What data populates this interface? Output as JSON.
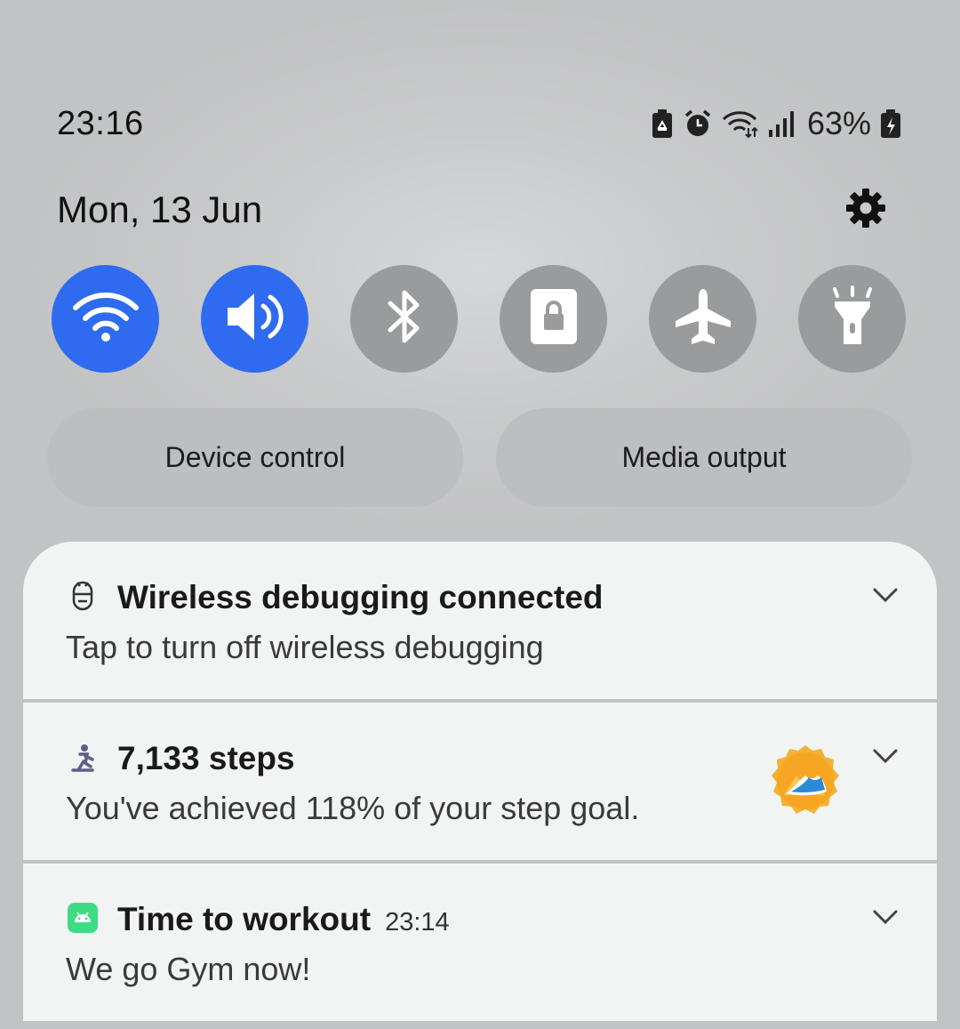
{
  "status_bar": {
    "time": "23:16",
    "battery_percent": "63%",
    "icons": [
      "recycle-battery-icon",
      "alarm-icon",
      "wifi-icon",
      "signal-icon",
      "battery-charging-icon"
    ]
  },
  "header": {
    "date": "Mon, 13 Jun",
    "settings_icon": "gear-icon"
  },
  "quick_toggles": [
    {
      "name": "wifi",
      "state": "on",
      "icon": "wifi-icon"
    },
    {
      "name": "sound",
      "state": "on",
      "icon": "volume-icon"
    },
    {
      "name": "bluetooth",
      "state": "off",
      "icon": "bluetooth-icon"
    },
    {
      "name": "secure-folder",
      "state": "off",
      "icon": "lock-icon"
    },
    {
      "name": "airplane-mode",
      "state": "off",
      "icon": "airplane-icon"
    },
    {
      "name": "flashlight",
      "state": "off",
      "icon": "flashlight-icon"
    }
  ],
  "buttons": {
    "device_control": "Device control",
    "media_output": "Media output"
  },
  "notifications": [
    {
      "title": "Wireless debugging connected",
      "body": "Tap to turn off wireless debugging",
      "icon": "android-debug-icon"
    },
    {
      "title": "7,133 steps",
      "body": "You've achieved 118% of your step goal.",
      "icon": "walking-person-icon",
      "badge_icon": "sneaker-badge-icon"
    },
    {
      "title": "Time to workout",
      "time": "23:14",
      "body": "We go Gym now!",
      "icon": "android-app-icon"
    }
  ],
  "colors": {
    "toggle_on": "#2f6bf0",
    "toggle_off": "#9a9b9d",
    "card_bg": "#f2f3f3"
  }
}
